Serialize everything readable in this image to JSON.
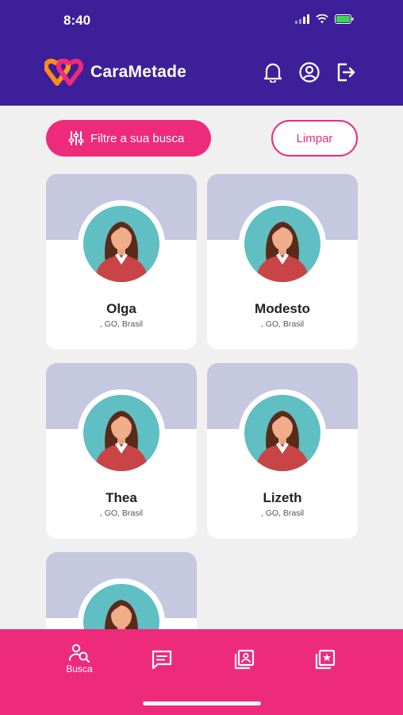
{
  "status_bar": {
    "time": "8:40"
  },
  "brand": {
    "name": "CaraMetade"
  },
  "header": {
    "icons": [
      "bell-icon",
      "user-circle-icon",
      "logout-icon"
    ]
  },
  "filters": {
    "filter_label": "Filtre a sua busca",
    "clear_label": "Limpar"
  },
  "profiles": [
    {
      "name": "Olga",
      "location": ", GO, Brasil"
    },
    {
      "name": "Modesto",
      "location": ", GO, Brasil"
    },
    {
      "name": "Thea",
      "location": ", GO, Brasil"
    },
    {
      "name": "Lizeth",
      "location": ", GO, Brasil"
    },
    {
      "name": "",
      "location": ""
    }
  ],
  "bottom_nav": {
    "items": [
      {
        "label": "Busca",
        "icon": "search-user-icon",
        "active": true
      },
      {
        "label": "",
        "icon": "chat-icon"
      },
      {
        "label": "",
        "icon": "contacts-icon"
      },
      {
        "label": "",
        "icon": "favorites-icon"
      }
    ]
  },
  "colors": {
    "header": "#3d1f99",
    "accent": "#ee2a7b",
    "banner": "#c5c8de",
    "avatar_bg": "#5fbfc2"
  }
}
